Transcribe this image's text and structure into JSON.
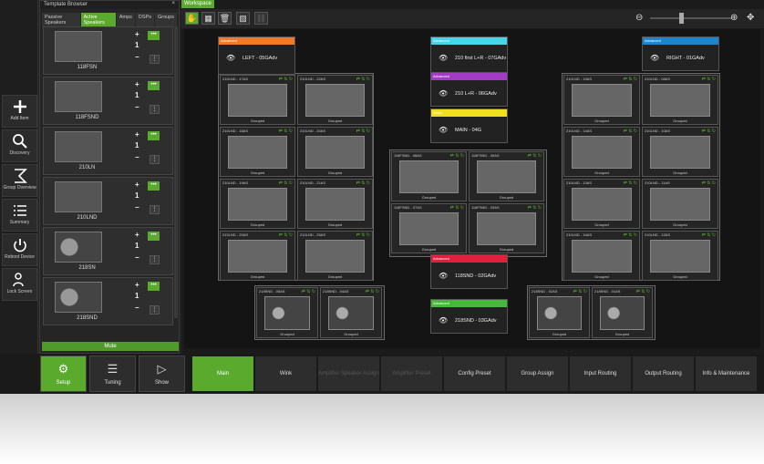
{
  "left_bar": [
    {
      "name": "add-item",
      "label": "Add Item"
    },
    {
      "name": "discovery",
      "label": "Discovery"
    },
    {
      "name": "group-overview",
      "label": "Group Overview"
    },
    {
      "name": "summary",
      "label": "Summary"
    },
    {
      "name": "reboot-device",
      "label": "Reboot Device"
    },
    {
      "name": "lock-screen",
      "label": "Lock Screen"
    }
  ],
  "template": {
    "title": "Template Browser",
    "close": "×",
    "tabs": [
      "Passive Speakers",
      "Active Speakers",
      "Amps",
      "DSPs",
      "Groups"
    ],
    "active_tab": "Active Speakers",
    "items": [
      {
        "name": "118FSN",
        "qty": "1",
        "type": "box"
      },
      {
        "name": "118FSND",
        "qty": "1",
        "type": "box"
      },
      {
        "name": "210LN",
        "qty": "1",
        "type": "box"
      },
      {
        "name": "210LND",
        "qty": "1",
        "type": "box"
      },
      {
        "name": "218SN",
        "qty": "1",
        "type": "sub"
      },
      {
        "name": "218SND",
        "qty": "1",
        "type": "sub"
      }
    ],
    "mute": "Mute"
  },
  "workspace": {
    "tab": "Workspace",
    "labels": [
      {
        "tag": "Advanced",
        "name": "LEFT - 05GAdv",
        "color": "#f07a28"
      },
      {
        "tag": "Advanced",
        "name": "210 first L+R - 07GAdv",
        "color": "#47d6e8"
      },
      {
        "tag": "Advanced",
        "name": "210 L+R - 06GAdv",
        "color": "#a23cc4"
      },
      {
        "tag": "Basic",
        "name": "MAIN - 04G",
        "color": "#f0e020"
      },
      {
        "tag": "Advanced",
        "name": "RIGHT - 01GAdv",
        "color": "#1e86cc"
      },
      {
        "tag": "Advanced",
        "name": "118SND - 02GAdv",
        "color": "#e0203c"
      },
      {
        "tag": "Advanced",
        "name": "218SND - 03GAdv",
        "color": "#46b83c"
      }
    ],
    "left_speakers": [
      "210LND - 17AS",
      "210LND - 22AS",
      "210LND - 18AS",
      "210LND - 20AS",
      "210LND - 19AS",
      "210LND - 21AS",
      "210LND - 20AS",
      "210LND - 25AS"
    ],
    "right_speakers": [
      "210LND - 15AS",
      "210LND - 08AS",
      "210LND - 14AS",
      "210LND - 10AS",
      "210LND - 13AS",
      "210LND - 11AS",
      "210LND - 16AS",
      "210LND - 12AS"
    ],
    "center_speakers": [
      "118FSND - 08AS",
      "118FSND - 09AS",
      "118FSND - 07AS",
      "118FSND - 03AS"
    ],
    "sub_left": [
      "218SND - 05AS",
      "218SND - 04AS"
    ],
    "sub_right": [
      "218SND - 02AS",
      "218SND - 01AS"
    ],
    "grouped": "Grouped"
  },
  "bottom": {
    "main_buttons": [
      {
        "label": "Setup",
        "icon": "gear-icon"
      },
      {
        "label": "Tuning",
        "icon": "sliders-icon"
      },
      {
        "label": "Show",
        "icon": "play-icon"
      }
    ],
    "tabs": [
      "Main",
      "Wink",
      "Amplifier Speaker Assign",
      "Amplifier Preset",
      "Config Preset",
      "Group Assign",
      "Input Routing",
      "Output Routing",
      "Info & Maintenance"
    ],
    "disabled_tabs": [
      "Amplifier Speaker Assign",
      "Amplifier Preset"
    ]
  }
}
